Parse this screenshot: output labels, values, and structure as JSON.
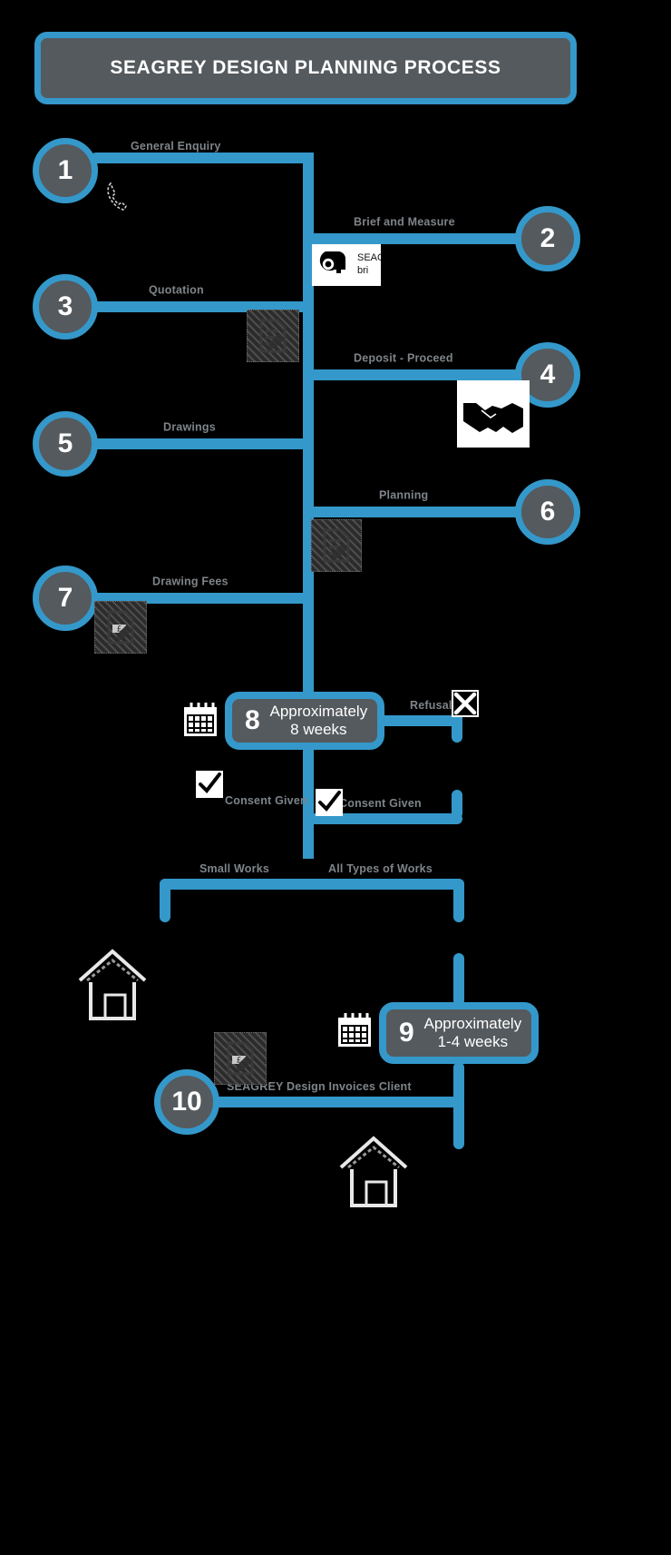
{
  "title": {
    "text": "SEAGREY DESIGN PLANNING PROCESS"
  },
  "colors": {
    "accent": "#3498ca",
    "node_fill": "#555a5e",
    "label": "#7e8489",
    "background": "#000000",
    "title_text": "#ffffff"
  },
  "steps": [
    {
      "number": "1",
      "label": "General Enquiry",
      "icon": "phone-icon"
    },
    {
      "number": "2",
      "label": "Brief and Measure",
      "icon": "tape-measure-icon"
    },
    {
      "number": "3",
      "label": "Quotation",
      "icon": "document-broken-image-icon"
    },
    {
      "number": "4",
      "label": "Deposit - Proceed",
      "icon": "handshake-icon"
    },
    {
      "number": "5",
      "label": "Drawings",
      "icon": "none"
    },
    {
      "number": "6",
      "label": "Planning",
      "icon": "document-broken-image-icon"
    },
    {
      "number": "7",
      "label": "Drawing Fees",
      "icon": "invoice-broken-image-icon"
    },
    {
      "number": "10",
      "label": "SEAGREY Design Invoices Client",
      "icon": "invoice-broken-image-icon"
    }
  ],
  "duration_boxes": [
    {
      "number": "8",
      "line1": "Approximately",
      "line2": "8 weeks",
      "icon": "calendar-icon"
    },
    {
      "number": "9",
      "line1": "Approximately",
      "line2": "1-4 weeks",
      "icon": "calendar-icon"
    }
  ],
  "branch_labels": {
    "refusal": "Refusal",
    "consent_left": "Consent Given",
    "consent_right": "Consent Given",
    "small_works": "Small Works",
    "all_types_of_works": "All Types of Works"
  },
  "measure_note": {
    "line1": "SEAG",
    "line2": "bri"
  },
  "icons": {
    "phone": "phone-icon",
    "tape_measure": "tape-measure-icon",
    "handshake": "handshake-icon",
    "calendar": "calendar-icon",
    "check": "check-icon",
    "cross": "cross-icon",
    "house": "house-icon",
    "broken_image": "broken-image-icon"
  }
}
